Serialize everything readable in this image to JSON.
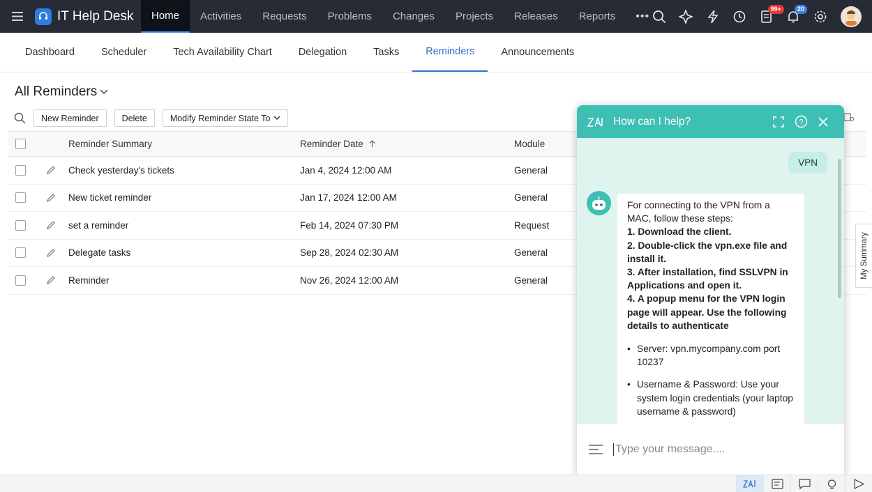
{
  "app": {
    "title": "IT Help Desk"
  },
  "nav": {
    "items": [
      "Home",
      "Activities",
      "Requests",
      "Problems",
      "Changes",
      "Projects",
      "Releases",
      "Reports"
    ],
    "more": "•••",
    "badges": {
      "tasks": "99+",
      "notifications": "20"
    }
  },
  "subtabs": [
    "Dashboard",
    "Scheduler",
    "Tech Availability Chart",
    "Delegation",
    "Tasks",
    "Reminders",
    "Announcements"
  ],
  "page": {
    "title": "All Reminders"
  },
  "toolbar": {
    "new": "New Reminder",
    "delete": "Delete",
    "modify": "Modify Reminder State To"
  },
  "table": {
    "headers": {
      "summary": "Reminder Summary",
      "date": "Reminder Date",
      "module": "Module"
    },
    "rows": [
      {
        "summary": "Check yesterday's tickets",
        "date": "Jan 4, 2024 12:00 AM",
        "module": "General"
      },
      {
        "summary": "New ticket reminder",
        "date": "Jan 17, 2024 12:00 AM",
        "module": "General"
      },
      {
        "summary": "set a reminder",
        "date": "Feb 14, 2024 07:30 PM",
        "module": "Request"
      },
      {
        "summary": "Delegate tasks",
        "date": "Sep 28, 2024 02:30 AM",
        "module": "General"
      },
      {
        "summary": "Reminder",
        "date": "Nov 26, 2024 12:00 AM",
        "module": "General"
      }
    ]
  },
  "chat": {
    "title": "How can I help?",
    "user_message": "VPN",
    "bot_intro": "For connecting to the VPN from a MAC, follow these steps:",
    "bot_steps": [
      "1. Download the client.",
      "2. Double-click the vpn.exe file and install it.",
      "3. After installation, find SSLVPN in Applications and open it.",
      "4. A popup menu for the VPN login page will appear. Use the following details to authenticate"
    ],
    "bot_bullets": [
      "Server: vpn.mycompany.com port 10237",
      "Username & Password: Use your system login credentials (your laptop username & password)"
    ],
    "input_placeholder": "Type your message...."
  },
  "side_tab": "My Summary",
  "colors": {
    "topbar": "#262b36",
    "accent": "#2f74c8",
    "chat": "#3ebfb3"
  }
}
